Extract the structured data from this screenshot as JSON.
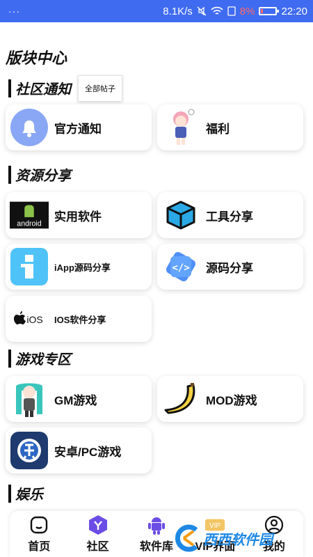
{
  "status_bar": {
    "dots": "···",
    "speed": "8.1K/s",
    "battery_pct": "8%",
    "time": "22:20"
  },
  "page": {
    "title": "版块中心"
  },
  "sections": {
    "community": {
      "title": "社区通知",
      "all_posts_button": "全部帖子"
    },
    "resources": {
      "title": "资源分享"
    },
    "games": {
      "title": "游戏专区"
    },
    "entertainment": {
      "title": "娱乐"
    }
  },
  "cards": {
    "official": "官方通知",
    "welfare": "福利",
    "apps": "实用软件",
    "tools": "工具分享",
    "iapp": "iApp源码分享",
    "source": "源码分享",
    "ios": "IOS软件分享",
    "gm": "GM游戏",
    "mod": "MOD游戏",
    "android_pc": "安卓/PC游戏"
  },
  "icon_text": {
    "android": "android",
    "ios": "iOS",
    "vip": "VIP"
  },
  "bottom_nav": [
    {
      "label": "首页",
      "icon": "home-icon"
    },
    {
      "label": "社区",
      "icon": "community-icon"
    },
    {
      "label": "软件库",
      "icon": "android-robot-icon"
    },
    {
      "label": "VIP界面",
      "icon": "vip-icon"
    },
    {
      "label": "我的",
      "icon": "profile-icon"
    }
  ],
  "watermark": {
    "text": "西西软件园"
  },
  "colors": {
    "status_bar": "#3f6bf0",
    "accent_purple": "#6b4de6",
    "bell_blue": "#8aa7f5"
  }
}
